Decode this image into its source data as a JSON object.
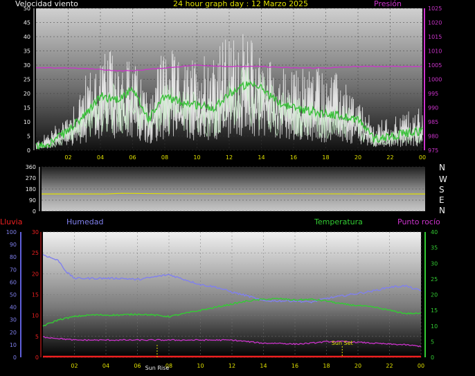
{
  "header": {
    "wind_label": "Velocidad viento",
    "title": "24 hour graph day : 12 Marzo 2025",
    "pressure_label": "Presión"
  },
  "bottom_header": {
    "rain_label": "Lluvia",
    "humidity_label": "Humedad",
    "temperature_label": "Temperatura",
    "dewpoint_label": "Punto rocío"
  },
  "colors": {
    "background": "#000000",
    "wind_gust": "#f2f2f2",
    "wind_avg": "#38c038",
    "wind_light": "#c8f5c8",
    "pressure": "#cc33cc",
    "direction": "#e0e000",
    "humidity": "#8080ee",
    "temperature": "#33cc33",
    "dewpoint": "#cc33cc",
    "rain": "#ee2020",
    "sun": "#e0e000"
  },
  "chart_data": [
    {
      "type": "line",
      "name": "wind-speed-pressure",
      "x_ticks": [
        "02",
        "04",
        "06",
        "08",
        "10",
        "12",
        "14",
        "16",
        "18",
        "20",
        "22",
        "00"
      ],
      "x_range_hours": [
        0,
        24
      ],
      "y_left_ticks": [
        "0",
        "5",
        "10",
        "15",
        "20",
        "25",
        "30",
        "35",
        "40",
        "45",
        "50"
      ],
      "y_left_range": [
        0,
        50
      ],
      "y_right_ticks": [
        "975",
        "980",
        "985",
        "990",
        "995",
        "1000",
        "1005",
        "1010",
        "1015",
        "1020",
        "1025"
      ],
      "y_right_range": [
        975,
        1025
      ],
      "gust_envelope": {
        "x": [
          0,
          1,
          2,
          3,
          4,
          5,
          6,
          7,
          8,
          9,
          10,
          11,
          12,
          13,
          14,
          15,
          16,
          17,
          18,
          19,
          20,
          21,
          22,
          23,
          24
        ],
        "y": [
          3,
          8,
          14,
          26,
          34,
          36,
          32,
          22,
          40,
          30,
          34,
          38,
          40,
          42,
          36,
          30,
          28,
          32,
          30,
          26,
          18,
          10,
          12,
          14,
          16
        ]
      },
      "avg_wind": {
        "x": [
          0,
          1,
          2,
          3,
          4,
          5,
          6,
          7,
          8,
          9,
          10,
          11,
          12,
          13,
          14,
          15,
          16,
          17,
          18,
          19,
          20,
          21,
          22,
          23,
          24
        ],
        "y": [
          1,
          3,
          7,
          12,
          19,
          18,
          21,
          11,
          19,
          17,
          16,
          15,
          20,
          23,
          22,
          17,
          15,
          14,
          13,
          12,
          11,
          4,
          5,
          6,
          7
        ]
      },
      "pressure": {
        "x": [
          0,
          2,
          4,
          5,
          6,
          8,
          10,
          12,
          14,
          16,
          18,
          20,
          22,
          24
        ],
        "y": [
          1004,
          1004,
          1003.5,
          1003,
          1003,
          1004,
          1005,
          1004.5,
          1004.5,
          1004,
          1004,
          1004.5,
          1004.5,
          1004.5
        ]
      }
    },
    {
      "type": "line",
      "name": "wind-direction",
      "x_range_hours": [
        0,
        24
      ],
      "y_ticks": [
        "360",
        "270",
        "180",
        "90",
        "0"
      ],
      "y_range": [
        0,
        360
      ],
      "compass": [
        "N",
        "W",
        "S",
        "E",
        "N"
      ],
      "direction": {
        "x": [
          0,
          4,
          5,
          8,
          12,
          16,
          20,
          24
        ],
        "y": [
          140,
          140,
          145,
          142,
          140,
          142,
          140,
          140
        ]
      }
    },
    {
      "type": "line",
      "name": "humidity-temperature",
      "x_ticks": [
        "02",
        "04",
        "06",
        "08",
        "10",
        "12",
        "14",
        "16",
        "18",
        "20",
        "22",
        "00"
      ],
      "x_range_hours": [
        0,
        24
      ],
      "humidity_ticks": [
        "0",
        "10",
        "20",
        "30",
        "40",
        "50",
        "60",
        "70",
        "80",
        "90",
        "100"
      ],
      "humidity_range": [
        0,
        100
      ],
      "rain_ticks": [
        "0",
        "5",
        "10",
        "15",
        "20",
        "25",
        "30"
      ],
      "rain_range": [
        0,
        30
      ],
      "temp_ticks": [
        "0",
        "5",
        "10",
        "15",
        "20",
        "25",
        "30",
        "35",
        "40"
      ],
      "temp_range": [
        0,
        40
      ],
      "humidity": {
        "x": [
          0,
          1,
          1.5,
          2,
          3,
          4,
          5,
          6,
          7,
          8,
          9,
          10,
          11,
          12,
          13,
          14,
          15,
          16,
          17,
          18,
          19,
          20,
          21,
          22,
          23,
          24
        ],
        "y": [
          82,
          77,
          68,
          63,
          63,
          63,
          63,
          62,
          64,
          66,
          62,
          58,
          56,
          52,
          49,
          45,
          45,
          45,
          44,
          47,
          49,
          51,
          53,
          56,
          57,
          53
        ]
      },
      "temperature": {
        "x": [
          0,
          1,
          2,
          3,
          4,
          5,
          6,
          7,
          8,
          9,
          10,
          11,
          12,
          13,
          14,
          15,
          16,
          17,
          18,
          19,
          20,
          21,
          22,
          23,
          24
        ],
        "y": [
          10,
          12,
          13,
          13.5,
          13.5,
          13.5,
          13.8,
          13.5,
          13,
          14,
          15,
          16,
          17,
          18,
          18.5,
          18.7,
          18.3,
          18.5,
          18,
          17,
          16.5,
          16,
          15,
          14,
          14
        ]
      },
      "dewpoint": {
        "x": [
          0,
          1,
          2,
          3,
          4,
          5,
          6,
          7,
          8,
          9,
          10,
          11,
          12,
          13,
          14,
          15,
          16,
          17,
          18,
          19,
          20,
          21,
          22,
          23,
          24
        ],
        "y": [
          6.5,
          6,
          5.5,
          5.5,
          5.5,
          5.5,
          5.5,
          5.5,
          5.5,
          5.5,
          5.5,
          5.5,
          5.5,
          5,
          4.5,
          4.5,
          4.2,
          4.5,
          5,
          5,
          4.8,
          4.5,
          4.2,
          4,
          3.5
        ]
      },
      "rain": {
        "x": [
          0,
          24
        ],
        "y": [
          0,
          0
        ]
      },
      "sun_rise": {
        "label": "Sun Rise",
        "hour": 7.25
      },
      "sun_set": {
        "label": "Sun Set",
        "hour": 19.0
      }
    }
  ]
}
